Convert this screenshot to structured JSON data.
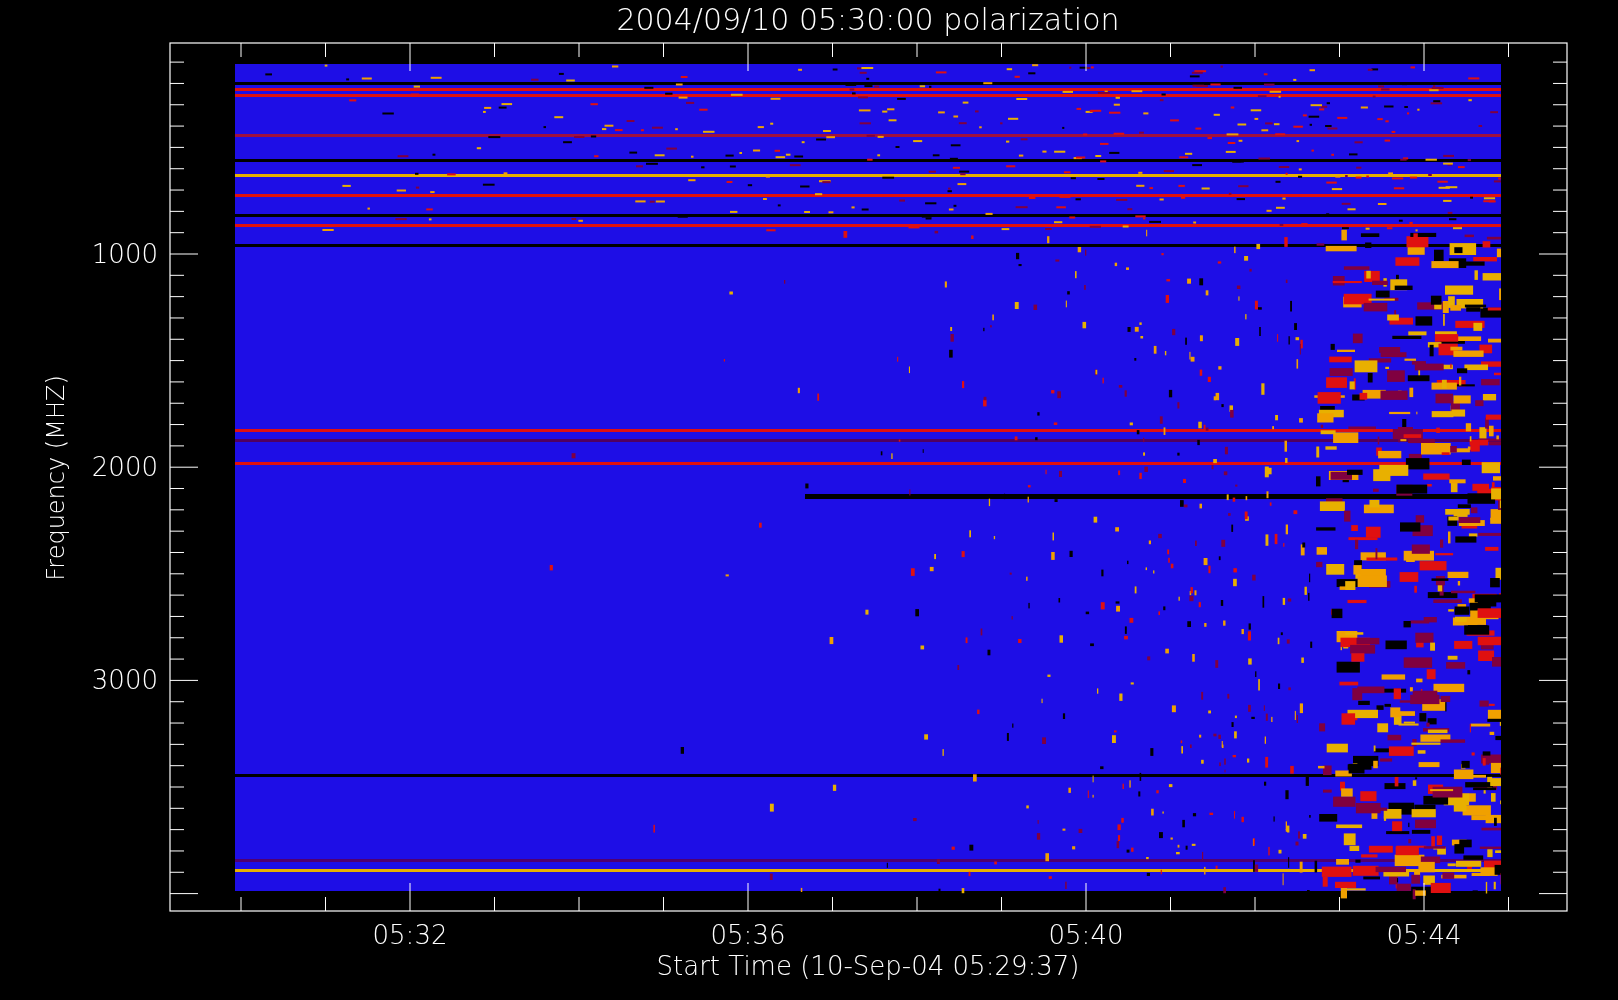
{
  "title": "2004/09/10 05:30:00 polarization",
  "y_axis": {
    "label": "Frequency (MHZ)",
    "ticks": [
      "1000",
      "2000",
      "3000"
    ]
  },
  "x_axis": {
    "label": "Start Time (10-Sep-04 05:29:37)",
    "ticks": [
      "05:32",
      "05:36",
      "05:40",
      "05:44"
    ]
  }
}
